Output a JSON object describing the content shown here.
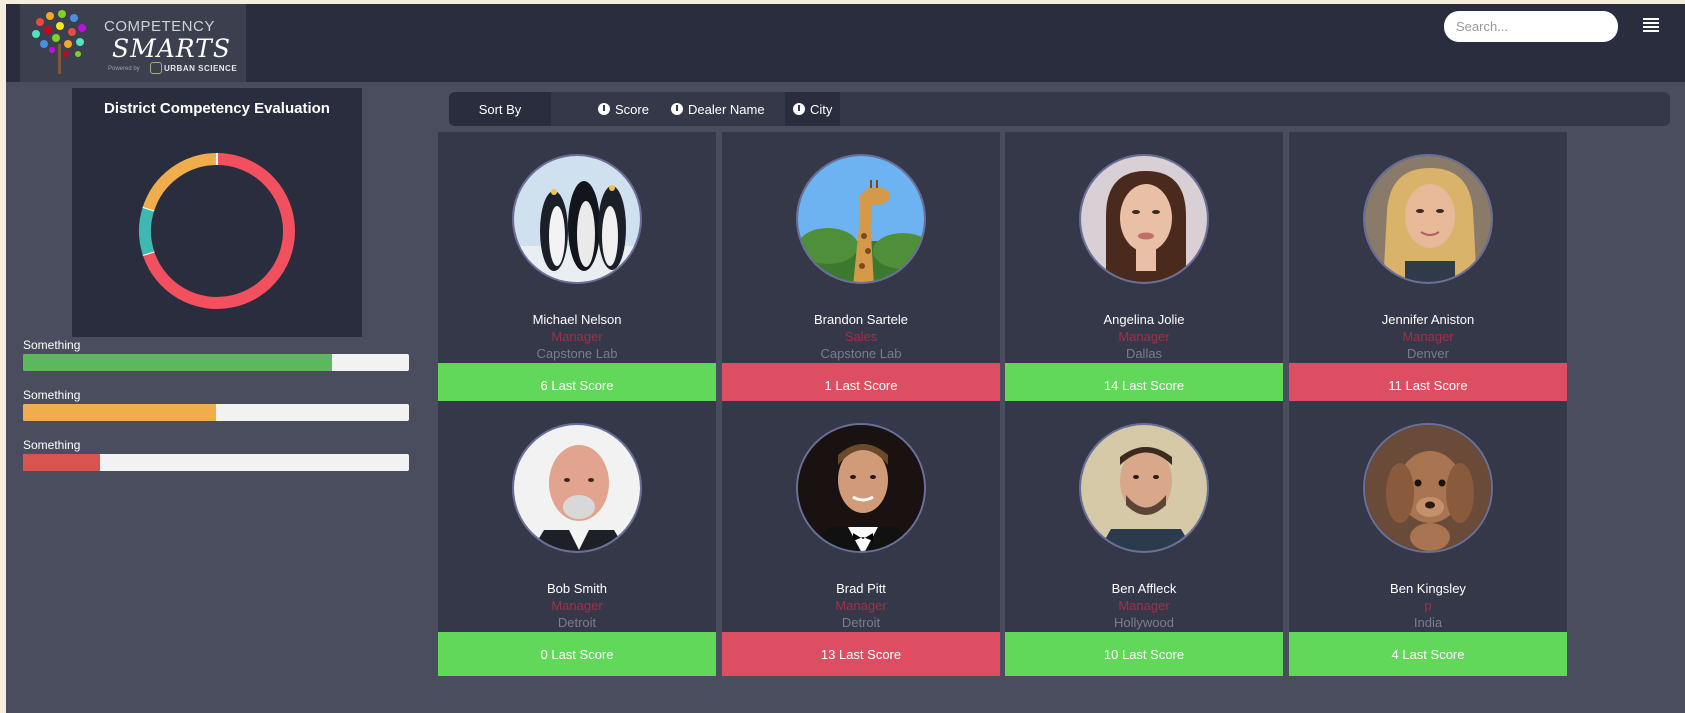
{
  "header": {
    "logo": {
      "line1": "COMPETENCY",
      "line2": "SMARTS",
      "powered_by": "Powered by",
      "partner": "URBAN SCIENCE"
    },
    "search": {
      "placeholder": "Search..."
    },
    "menu_icon": "list-icon"
  },
  "sidebar": {
    "chart_title": "District Competency Evaluation",
    "metrics": [
      {
        "label": "Something",
        "fill_percent": 80,
        "color": "#5cb85c"
      },
      {
        "label": "Something",
        "fill_percent": 50,
        "color": "#f0ad4e"
      },
      {
        "label": "Something",
        "fill_percent": 20,
        "color": "#d9534f"
      }
    ]
  },
  "sortbar": {
    "label": "Sort By",
    "options": [
      {
        "label": "Score",
        "icon": "arrow-circle-down-icon",
        "active": false
      },
      {
        "label": "Dealer Name",
        "icon": "arrow-circle-down-icon",
        "active": false
      },
      {
        "label": "City",
        "icon": "arrow-circle-down-icon",
        "active": true
      }
    ]
  },
  "cards": [
    {
      "name": "Michael Nelson",
      "role": "Manager",
      "city": "Capstone Lab",
      "score": "6 Last Score",
      "status": "green",
      "avatar": "penguins-photo"
    },
    {
      "name": "Brandon Sartele",
      "role": "Sales",
      "city": "Capstone Lab",
      "score": "1 Last Score",
      "status": "red",
      "avatar": "giraffe-photo"
    },
    {
      "name": "Angelina Jolie",
      "role": "Manager",
      "city": "Dallas",
      "score": "14 Last Score",
      "status": "green",
      "avatar": "woman-portrait-photo"
    },
    {
      "name": "Jennifer Aniston",
      "role": "Manager",
      "city": "Denver",
      "score": "11 Last Score",
      "status": "red",
      "avatar": "blonde-woman-photo"
    },
    {
      "name": "Bob Smith",
      "role": "Manager",
      "city": "Detroit",
      "score": "0 Last Score",
      "status": "green",
      "avatar": "bald-man-photo"
    },
    {
      "name": "Brad Pitt",
      "role": "Manager",
      "city": "Detroit",
      "score": "13 Last Score",
      "status": "red",
      "avatar": "man-tuxedo-photo"
    },
    {
      "name": "Ben Affleck",
      "role": "Manager",
      "city": "Hollywood",
      "score": "10 Last Score",
      "status": "green",
      "avatar": "man-portrait-photo"
    },
    {
      "name": "Ben Kingsley",
      "role": "p",
      "city": "India",
      "score": "4 Last Score",
      "status": "green",
      "avatar": "puppy-photo"
    }
  ],
  "chart_data": {
    "type": "pie",
    "title": "District Competency Evaluation",
    "donut": true,
    "slices": [
      {
        "value": 70,
        "color": "#f2505e"
      },
      {
        "value": 10,
        "color": "#3fb8b0"
      },
      {
        "value": 20,
        "color": "#f0ad4e"
      }
    ]
  }
}
